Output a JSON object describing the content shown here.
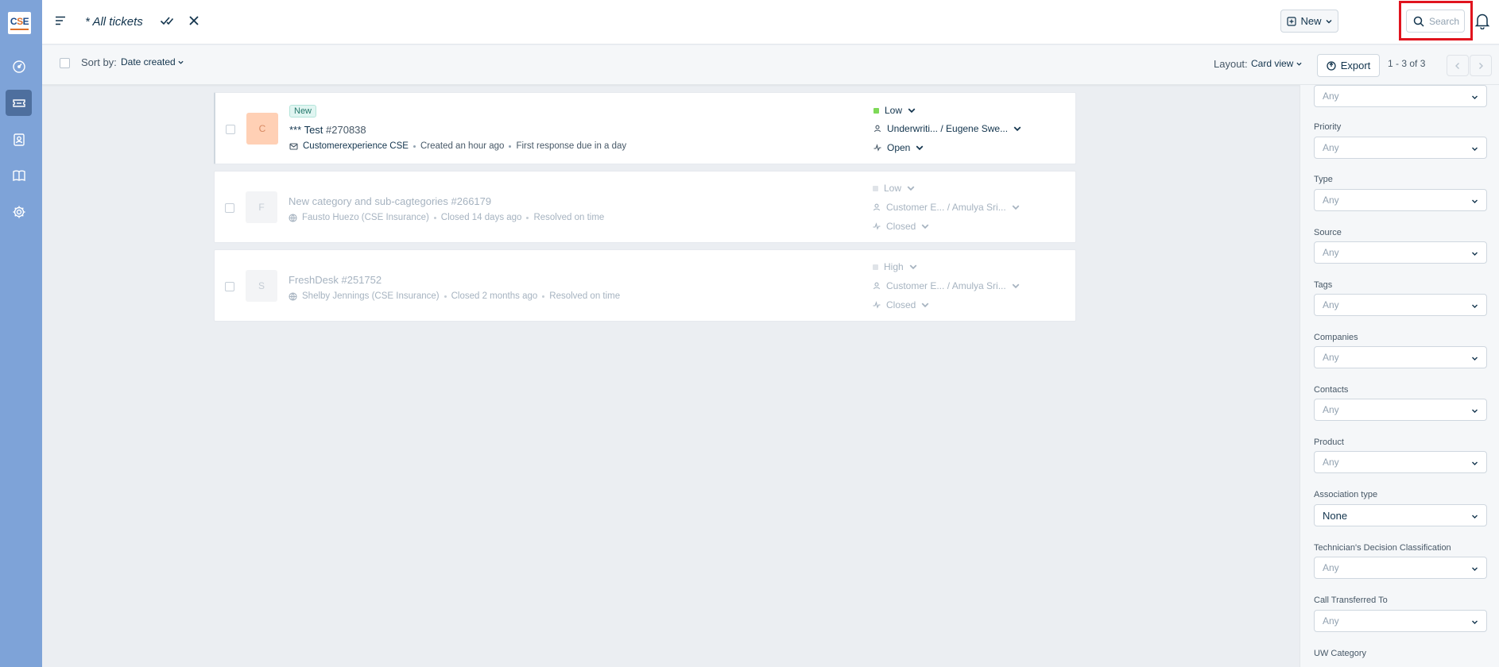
{
  "app": {
    "logo_text": "CSE",
    "brand_colors": {
      "nav_bg": "#7ea3d8",
      "nav_active": "#4e6f9e",
      "highlight": "#e0141e"
    }
  },
  "left_nav": {
    "items": [
      {
        "icon": "dashboard-icon",
        "active": false
      },
      {
        "icon": "tickets-icon",
        "active": true
      },
      {
        "icon": "contacts-icon",
        "active": false
      },
      {
        "icon": "knowledge-base-icon",
        "active": false
      },
      {
        "icon": "settings-icon",
        "active": false
      }
    ]
  },
  "header": {
    "view_title": "* All tickets",
    "new_button": "New",
    "search_placeholder": "Search"
  },
  "toolbar": {
    "sort_label": "Sort by:",
    "sort_value": "Date created",
    "layout_label": "Layout:",
    "layout_value": "Card view",
    "export_label": "Export",
    "pagination": "1 - 3 of 3"
  },
  "tickets": [
    {
      "avatar_letter": "C",
      "avatar_color": "#ffd0b5",
      "badge": "New",
      "title_prefix": "*** ",
      "subject": "Test",
      "ticket_id": "#270838",
      "requester": "Customerexperience CSE",
      "created": "Created an hour ago",
      "sla": "First response due in a day",
      "channel_icon": "email-icon",
      "priority": "Low",
      "priority_color": "#7ed957",
      "assignee": "Underwriti... / Eugene Swe...",
      "status": "Open"
    },
    {
      "avatar_letter": "F",
      "avatar_color": "#f3f4f6",
      "badge": "",
      "title_prefix": "",
      "subject": "New category and sub-cagtegories",
      "ticket_id": "#266179",
      "requester": "Fausto Huezo (CSE Insurance)",
      "created": "Closed 14 days ago",
      "sla": "Resolved on time",
      "channel_icon": "portal-icon",
      "priority": "Low",
      "priority_color": "#dfe3e8",
      "assignee": "Customer E... / Amulya Sri...",
      "status": "Closed"
    },
    {
      "avatar_letter": "S",
      "avatar_color": "#f3f4f6",
      "badge": "",
      "title_prefix": "",
      "subject": "FreshDesk",
      "ticket_id": "#251752",
      "requester": "Shelby Jennings (CSE Insurance)",
      "created": "Closed 2 months ago",
      "sla": "Resolved on time",
      "channel_icon": "portal-icon",
      "priority": "High",
      "priority_color": "#dfe3e8",
      "assignee": "Customer E... / Amulya Sri...",
      "status": "Closed"
    }
  ],
  "filters": [
    {
      "label": "",
      "value": "Any",
      "filled": false
    },
    {
      "label": "Priority",
      "value": "Any",
      "filled": false
    },
    {
      "label": "Type",
      "value": "Any",
      "filled": false
    },
    {
      "label": "Source",
      "value": "Any",
      "filled": false
    },
    {
      "label": "Tags",
      "value": "Any",
      "filled": false
    },
    {
      "label": "Companies",
      "value": "Any",
      "filled": false
    },
    {
      "label": "Contacts",
      "value": "Any",
      "filled": false
    },
    {
      "label": "Product",
      "value": "Any",
      "filled": false
    },
    {
      "label": "Association type",
      "value": "None",
      "filled": true
    },
    {
      "label": "Technician's Decision Classification",
      "value": "Any",
      "filled": false
    },
    {
      "label": "Call Transferred To",
      "value": "Any",
      "filled": false
    },
    {
      "label": "UW Category",
      "value": "",
      "filled": false
    }
  ]
}
